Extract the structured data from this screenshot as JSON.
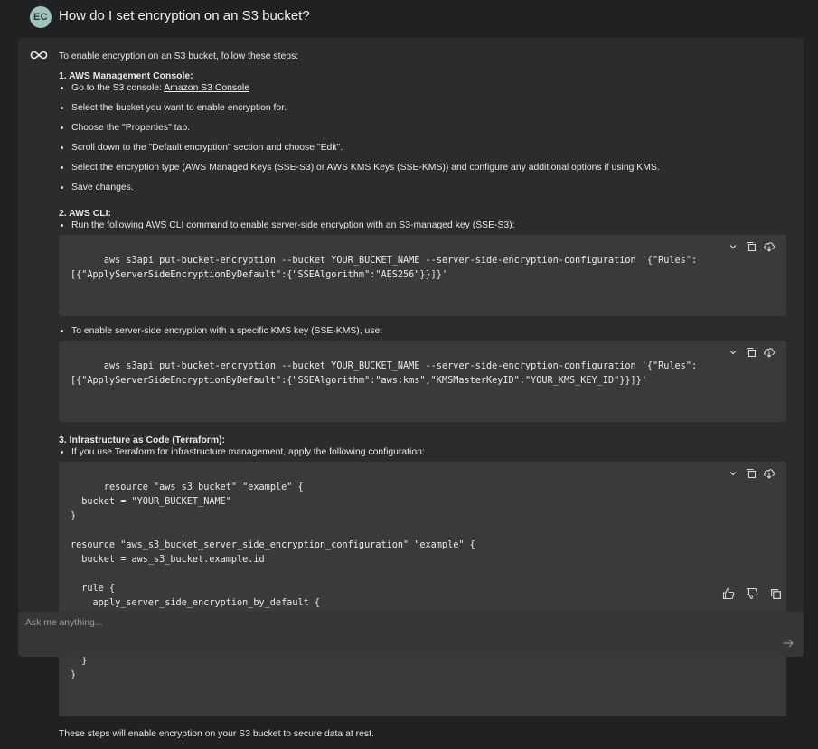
{
  "question": {
    "avatar_initials": "EC",
    "text": "How do I set encryption on an S3 bucket?"
  },
  "answer": {
    "intro": "To enable encryption on an S3 bucket, follow these steps:",
    "section1": {
      "title": "1. AWS Management Console:",
      "steps": [
        "Go to the S3 console: ",
        "Select the bucket you want to enable encryption for.",
        "Choose the \"Properties\" tab.",
        "Scroll down to the \"Default encryption\" section and choose \"Edit\".",
        "Select the encryption type (AWS Managed Keys (SSE-S3) or AWS KMS Keys (SSE-KMS)) and configure any additional options if using KMS.",
        "Save changes."
      ],
      "link_text": "Amazon S3 Console"
    },
    "section2": {
      "title": "2. AWS CLI:",
      "item1": "Run the following AWS CLI command to enable server-side encryption with an S3-managed key (SSE-S3):",
      "code1": "aws s3api put-bucket-encryption --bucket YOUR_BUCKET_NAME --server-side-encryption-configuration '{\"Rules\":\n[{\"ApplyServerSideEncryptionByDefault\":{\"SSEAlgorithm\":\"AES256\"}}]}'",
      "item2": "To enable server-side encryption with a specific KMS key (SSE-KMS), use:",
      "code2": "aws s3api put-bucket-encryption --bucket YOUR_BUCKET_NAME --server-side-encryption-configuration '{\"Rules\":\n[{\"ApplyServerSideEncryptionByDefault\":{\"SSEAlgorithm\":\"aws:kms\",\"KMSMasterKeyID\":\"YOUR_KMS_KEY_ID\"}}]}'"
    },
    "section3": {
      "title": "3. Infrastructure as Code (Terraform):",
      "item1": "If you use Terraform for infrastructure management, apply the following configuration:",
      "code": "resource \"aws_s3_bucket\" \"example\" {\n  bucket = \"YOUR_BUCKET_NAME\"\n}\n\nresource \"aws_s3_bucket_server_side_encryption_configuration\" \"example\" {\n  bucket = aws_s3_bucket.example.id\n\n  rule {\n    apply_server_side_encryption_by_default {\n      sse_algorithm     = \"AES256\" # Or \"aws:kms\"\n      kms_master_key_id = \"YOUR_KMS_KEY_ID\" # Only if using KMS\n    }\n  }\n}"
    },
    "closing": "These steps will enable encryption on your S3 bucket to secure data at rest."
  },
  "input": {
    "placeholder": "Ask me anything..."
  },
  "icons": {
    "bot": "infinity-icon",
    "code_tools": [
      "chevron-down-icon",
      "copy-icon",
      "download-icon"
    ],
    "feedback": [
      "thumbs-up-icon",
      "thumbs-down-icon",
      "copy-icon"
    ],
    "send": "send-arrow-icon"
  },
  "colors": {
    "background": "#1f2122",
    "card": "#2a2c2d",
    "code_block": "#383a3c",
    "input": "#343637",
    "avatar": "#9fc2bf"
  }
}
